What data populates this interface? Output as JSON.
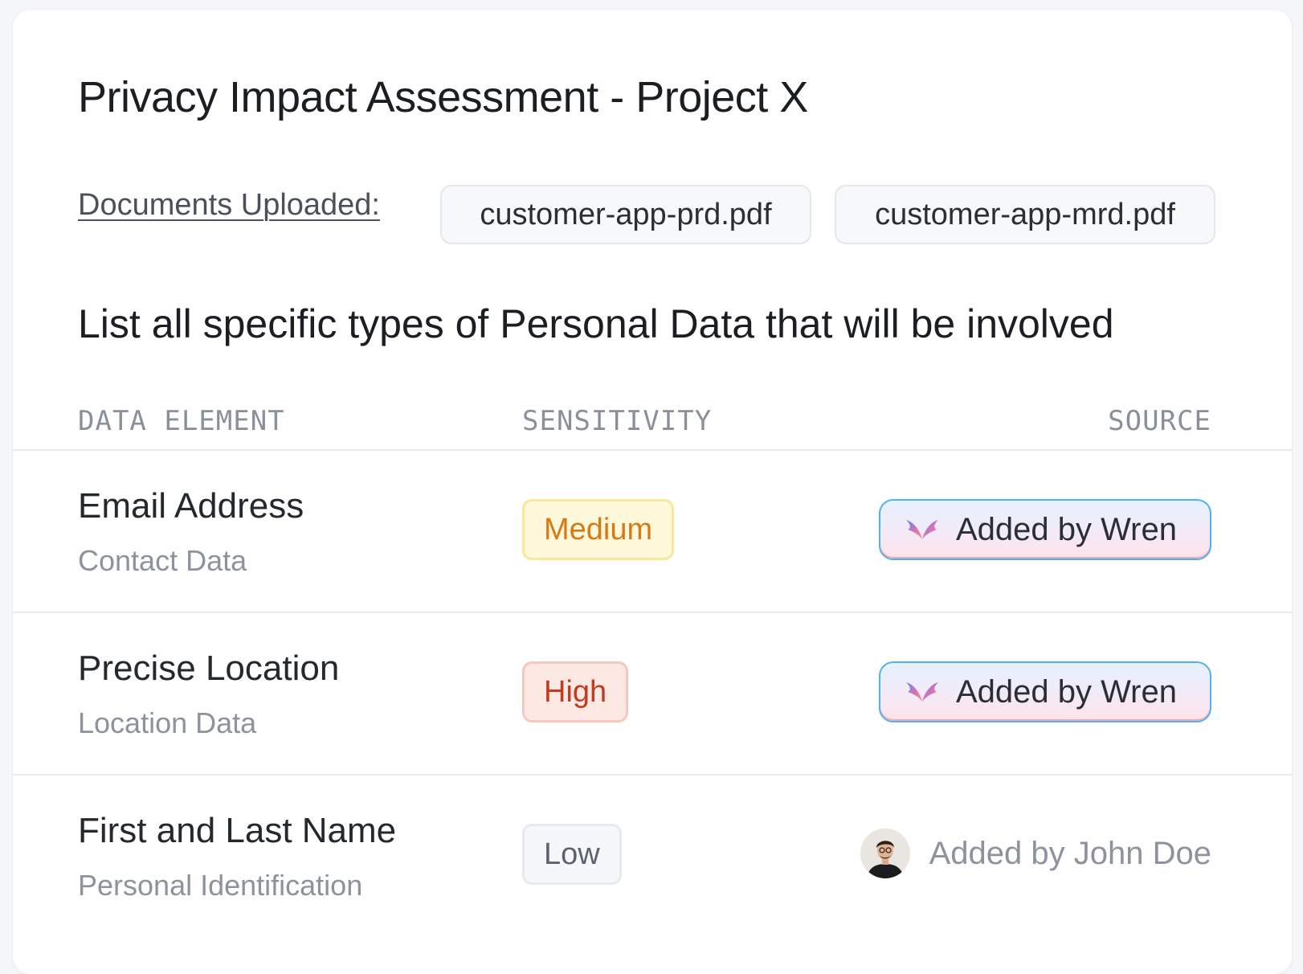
{
  "title": "Privacy Impact Assessment - Project X",
  "documents": {
    "label": "Documents Uploaded:",
    "files": [
      "customer-app-prd.pdf",
      "customer-app-mrd.pdf"
    ]
  },
  "question": "List all specific types of Personal Data that will be involved",
  "table": {
    "headers": [
      "DATA ELEMENT",
      "SENSITIVITY",
      "SOURCE"
    ],
    "rows": [
      {
        "element": "Email Address",
        "category": "Contact Data",
        "sensitivity": "Medium",
        "source": "Added by Wren",
        "source_icon": "wren-logo-icon"
      },
      {
        "element": "Precise Location",
        "category": "Location Data",
        "sensitivity": "High",
        "source": "Added by Wren",
        "source_icon": "wren-logo-icon"
      },
      {
        "element": "First and Last Name",
        "category": "Personal Identification",
        "sensitivity": "Low",
        "source": "Added by John Doe",
        "source_icon": "avatar"
      }
    ]
  },
  "colors": {
    "medium": "#d77a14",
    "high": "#c6391d",
    "low": "#5c6270",
    "wren_border": "#4fb3ee"
  }
}
